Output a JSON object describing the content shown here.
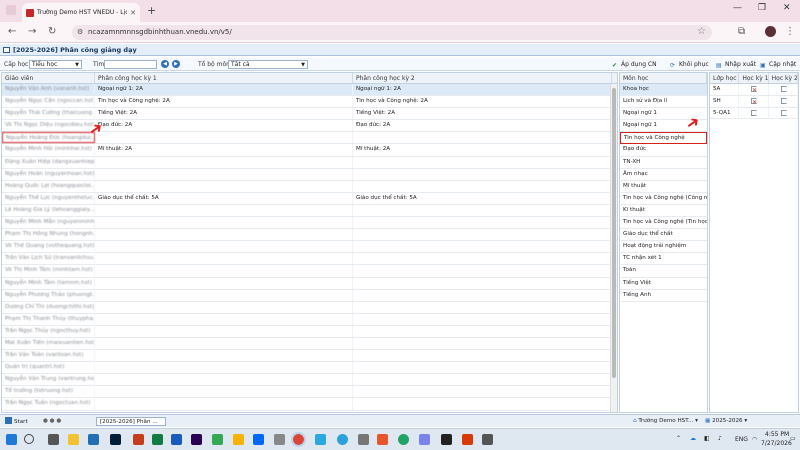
{
  "browser": {
    "tab_title": "Trường Demo HST VNEDU - Lịc",
    "url": "ncazamnmnnsgdbinhthuan.vnedu.vn/v5/"
  },
  "app": {
    "title": "[2025-2026] Phân công giảng dạy",
    "toolbar": {
      "cap_hoc_label": "Cấp học",
      "cap_hoc_value": "Tiểu học",
      "tim_label": "Tìm",
      "to_bo_mon_label": "Tổ bộ môn:",
      "to_bo_mon_value": "Tất cả",
      "apply_label": "Áp dụng CN",
      "restore_label": "Khôi phục",
      "import_export_label": "Nhập xuất",
      "update_label": "Cập nhật"
    }
  },
  "teacher_grid": {
    "headers": [
      "Giáo viên",
      "Phân công học kỳ 1",
      "Phân công học kỳ 2"
    ],
    "rows": [
      [
        "Nguyễn Văn Anh (vananh.hst)",
        "Ngoại ngữ 1: 2A",
        "Ngoại ngữ 1: 2A"
      ],
      [
        "Nguyễn Ngọc Cần (ngoccan.hst)",
        "Tin học và Công nghệ: 2A",
        "Tin học và Công nghệ: 2A"
      ],
      [
        "Nguyễn Thái Cường (thaicuong...)",
        "Tiếng Việt: 2A",
        "Tiếng Việt: 2A"
      ],
      [
        "Võ Thị Ngọc Diệu (ngocdieu.hst)",
        "Đạo đức: 2A",
        "Đạo đức: 2A"
      ],
      [
        "Nguyễn Hoàng Đức (hoangduc...)",
        "",
        ""
      ],
      [
        "Nguyễn Minh Hải (minhhai.hst)",
        "Mĩ thuật: 2A",
        "Mĩ thuật: 2A"
      ],
      [
        "Đặng Xuân Hiệp (dangxuanhiep...)",
        "",
        ""
      ],
      [
        "Nguyễn Hoàn (nguyenhoan.hst)",
        "",
        ""
      ],
      [
        "Hoàng Quốc Lợi (hoangquocloi...)",
        "",
        ""
      ],
      [
        "Nguyễn Thế Lực (nguyentheluc...)",
        "Giáo dục thể chất: 5A",
        "Giáo dục thể chất: 5A"
      ],
      [
        "Lê Hoàng Gia Lý (lehoanggialy...)",
        "",
        ""
      ],
      [
        "Nguyễn Minh Mẫn (nguyenminh...)",
        "",
        ""
      ],
      [
        "Phạm Thị Hồng Nhung (hongnh...)",
        "",
        ""
      ],
      [
        "Võ Thế Quang (vothequang.hst)",
        "",
        ""
      ],
      [
        "Trần Văn Lịch Sử (tranvanlichsu...)",
        "",
        ""
      ],
      [
        "Võ Thị Minh Tâm (minhtam.hst)",
        "",
        ""
      ],
      [
        "Nguyễn Minh Tâm (tamnm.hst)",
        "",
        ""
      ],
      [
        "Nguyễn Phương Thảo (phuongt...)",
        "",
        ""
      ],
      [
        "Dương Chí Thi (duongchithi.hst)",
        "",
        ""
      ],
      [
        "Phạm Thị Thanh Thủy (thuypha...)",
        "",
        ""
      ],
      [
        "Trần Ngọc Thủy (ngocthuy.hst)",
        "",
        ""
      ],
      [
        "Mai Xuân Tiến (maixuantien.hst)",
        "",
        ""
      ],
      [
        "Trần Văn Toàn (vantoan.hst)",
        "",
        ""
      ],
      [
        "Quản trị (quantri.hst)",
        "",
        ""
      ],
      [
        "Nguyễn Văn Trung (vantrung.hst)",
        "",
        ""
      ],
      [
        "Tổ trưởng (totruong.hst)",
        "",
        ""
      ],
      [
        "Trần Ngọc Tuấn (ngoctuan.hst)",
        "",
        ""
      ]
    ]
  },
  "subject_list": {
    "header": "Môn học",
    "items": [
      "Khoa học",
      "Lịch sử và Địa lí",
      "Ngoại ngữ 1",
      "Ngoại ngữ 1",
      "Tin học và Công nghệ",
      "Đạo đức",
      "TN-XH",
      "Âm nhạc",
      "Mĩ thuật",
      "Tin học và Công nghệ (Công n...",
      "Kĩ thuật",
      "Tin học và Công nghệ (Tin học)",
      "Giáo dục thể chất",
      "Hoạt động trải nghiệm",
      "TC nhận xét 1",
      "Toán",
      "Tiếng Việt",
      "Tiếng Anh"
    ]
  },
  "class_grid": {
    "headers": [
      "Lớp học",
      "Học kỳ 1",
      "Học kỳ 2"
    ],
    "rows": [
      {
        "name": "5A",
        "hk1": true,
        "hk2": false
      },
      {
        "name": "SH",
        "hk1": true,
        "hk2": false
      },
      {
        "name": "5-QA1",
        "hk1": false,
        "hk2": false
      }
    ]
  },
  "statusbar": {
    "start_label": "Start",
    "window_label": "[2025-2026] Phân ...",
    "school_label": "Trường Demo HST...",
    "year_label": "2025-2026"
  },
  "taskbar": {
    "lang": "ENG",
    "time": "4:55 PM",
    "date": "7/27/2026"
  }
}
